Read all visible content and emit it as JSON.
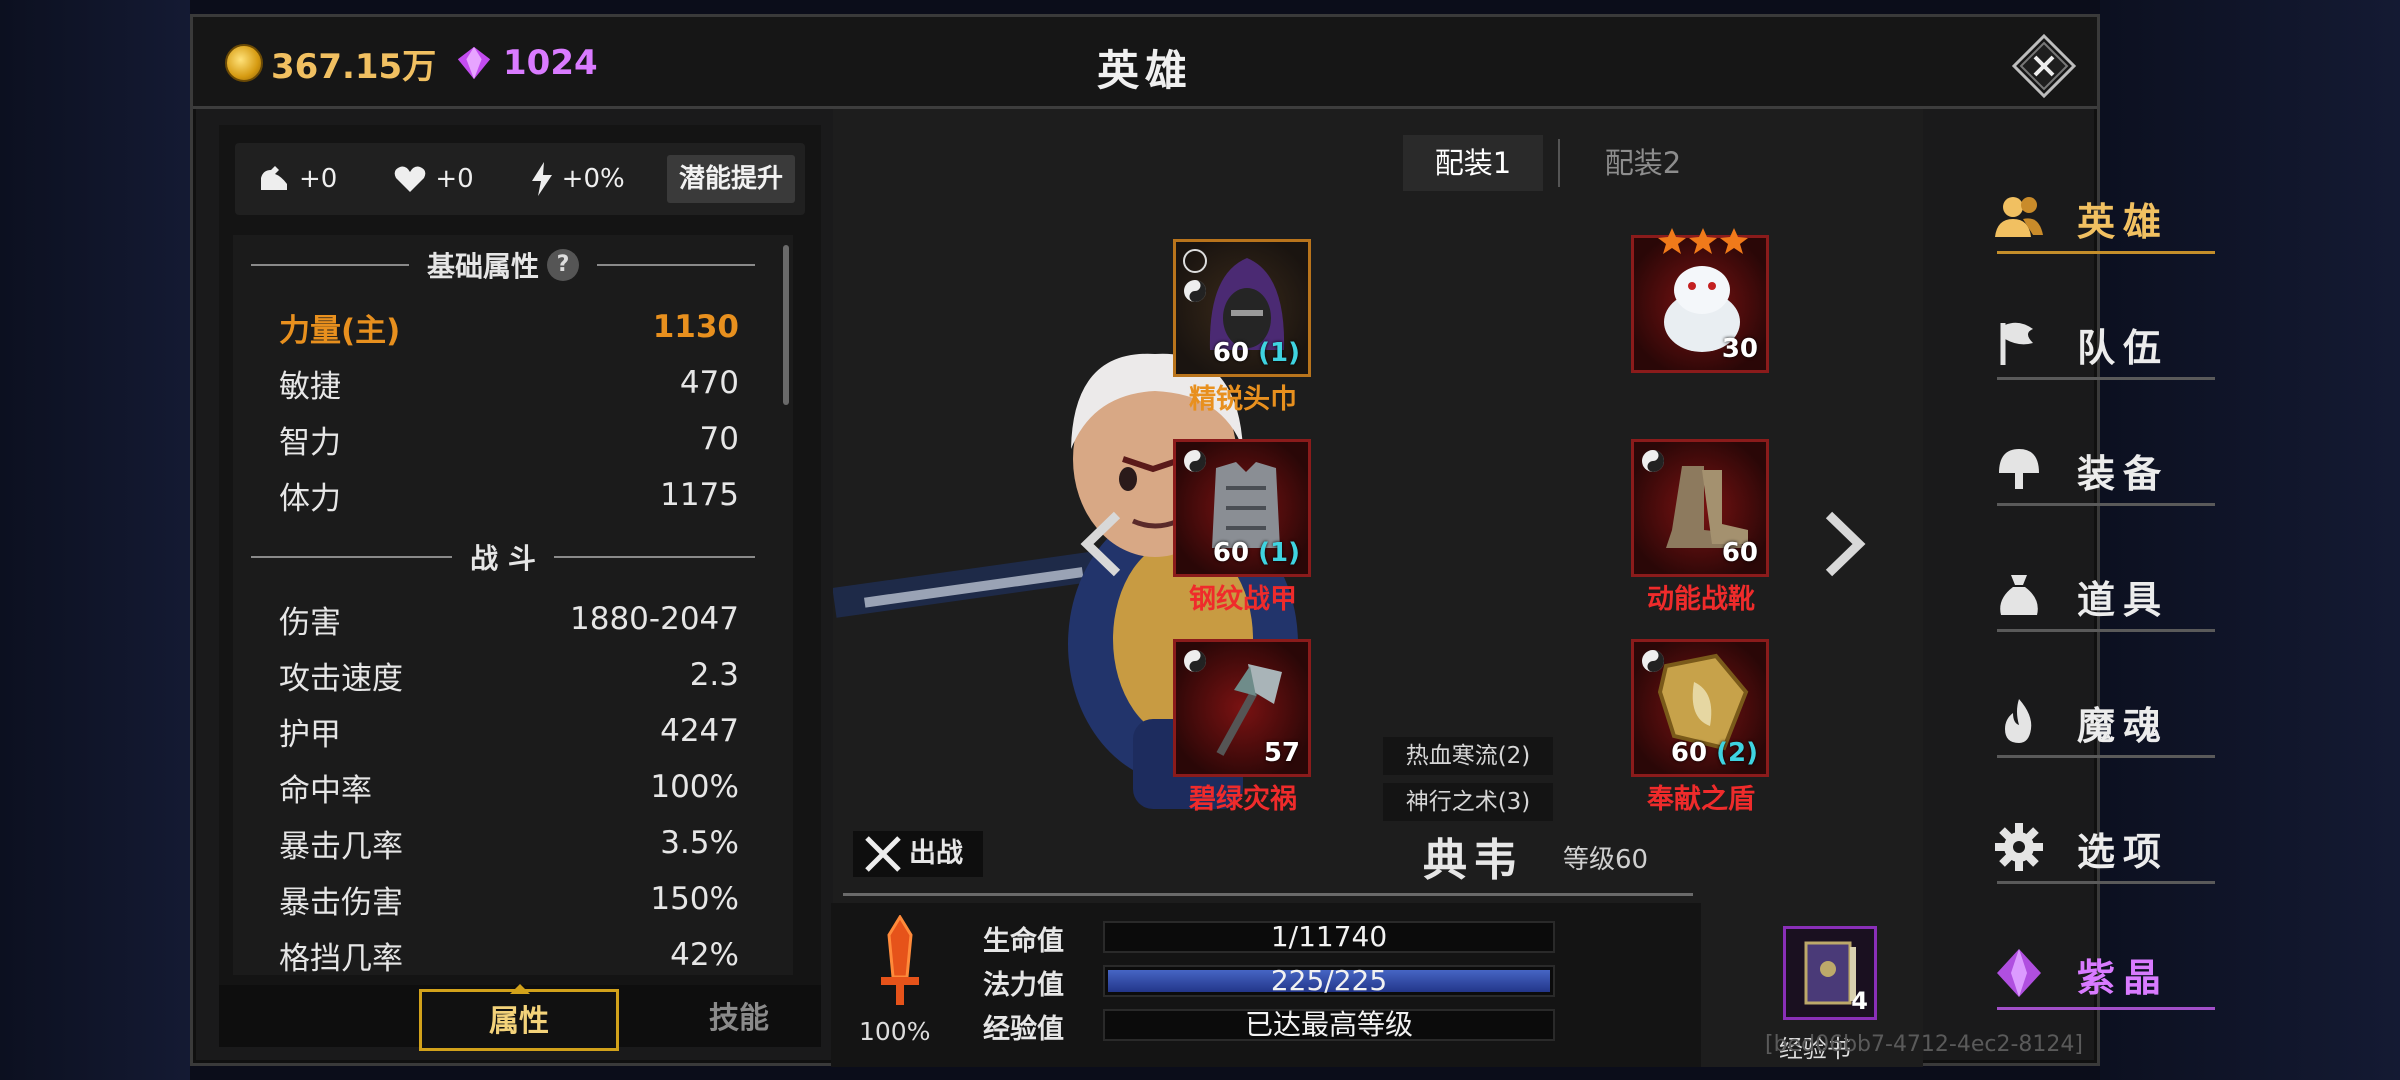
{
  "top_bar": {
    "gold": "367.15万",
    "gems": "1024",
    "title": "英雄"
  },
  "bonus_bar": {
    "strength_bonus": "+0",
    "health_bonus": "+0",
    "energy_bonus": "+0%",
    "potential_button": "潜能提升"
  },
  "attributes": {
    "base_header": "基础属性",
    "help_mark": "?",
    "base": [
      {
        "label": "力量(主)",
        "value": "1130"
      },
      {
        "label": "敏捷",
        "value": "470"
      },
      {
        "label": "智力",
        "value": "70"
      },
      {
        "label": "体力",
        "value": "1175"
      }
    ],
    "combat_header": "战 斗",
    "combat": [
      {
        "label": "伤害",
        "value": "1880-2047"
      },
      {
        "label": "攻击速度",
        "value": "2.3"
      },
      {
        "label": "护甲",
        "value": "4247"
      },
      {
        "label": "命中率",
        "value": "100%"
      },
      {
        "label": "暴击几率",
        "value": "3.5%"
      },
      {
        "label": "暴击伤害",
        "value": "150%"
      },
      {
        "label": "格挡几率",
        "value": "42%"
      }
    ]
  },
  "bottom_tabs": {
    "attributes": "属性",
    "skills": "技能"
  },
  "loadouts": {
    "tab1": "配装1",
    "tab2": "配装2"
  },
  "equipment": {
    "helmet": {
      "name": "精锐头巾",
      "level": "60",
      "bonus": "(1)"
    },
    "pet": {
      "level": "30"
    },
    "armor": {
      "name": "钢纹战甲",
      "level": "60",
      "bonus": "(1)"
    },
    "boots": {
      "name": "动能战靴",
      "level": "60"
    },
    "weapon": {
      "name": "碧绿灾祸",
      "level": "57"
    },
    "shield": {
      "name": "奉献之盾",
      "level": "60",
      "bonus": "(2)"
    }
  },
  "sets": {
    "set1": "热血寒流(2)",
    "set2": "神行之术(3)"
  },
  "hero": {
    "deploy_label": "出战",
    "name": "典韦",
    "level": "等级60"
  },
  "status": {
    "power_pct": "100%",
    "hp_label": "生命值",
    "hp_value": "1/11740",
    "hp_fraction": 0.0001,
    "mp_label": "法力值",
    "mp_value": "225/225",
    "mp_fraction": 1.0,
    "exp_label": "经验值",
    "exp_value": "已达最高等级",
    "exp_book_count": "4",
    "exp_book_label": "经验书"
  },
  "nav": {
    "hero": "英雄",
    "team": "队伍",
    "equipment": "装备",
    "items": "道具",
    "soul": "魔魂",
    "options": "选项",
    "crystal": "紫晶"
  },
  "uid": "[bed06bb7-4712-4ec2-8124]",
  "colors": {
    "accent_gold": "#f1c061",
    "rare_red": "#ef2b2b",
    "legend_orange": "#e8901e",
    "gem_purple": "#d97bff",
    "stat_highlight": "#e8901e"
  }
}
